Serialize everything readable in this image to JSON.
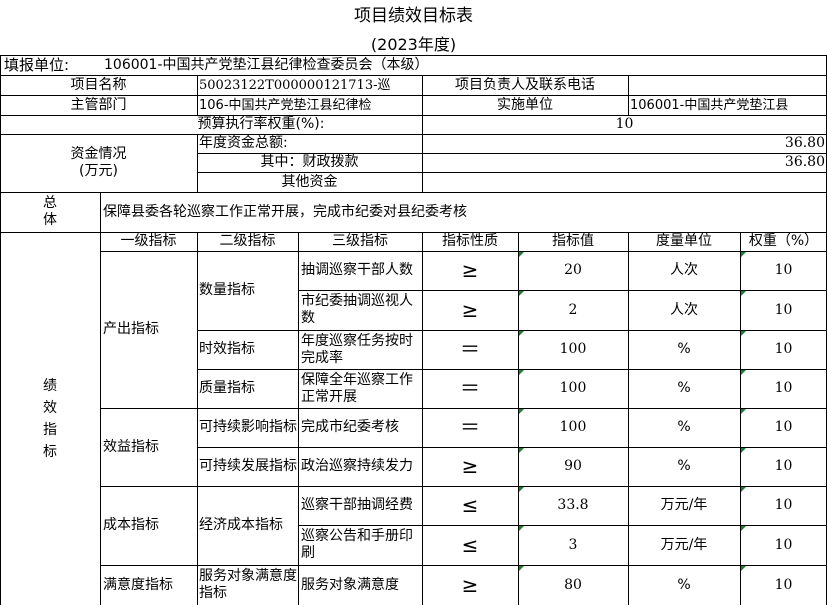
{
  "title": "项目绩效目标表",
  "subtitle": "(2023年度)",
  "reporter": {
    "label": "填报单位:",
    "value": "106001-中国共产党垫江县纪律检查委员会（本级）"
  },
  "project_name": {
    "label": "项目名称",
    "value": "50023122T000000121713-巡"
  },
  "contact": {
    "label": "项目负责人及联系电话",
    "value": ""
  },
  "dept": {
    "label": "主管部门",
    "value": "106-中国共产党垫江县纪律检"
  },
  "impl": {
    "label": "实施单位",
    "value": "106001-中国共产党垫江县"
  },
  "weight_row": {
    "label": "预算执行率权重(%):",
    "value": "10"
  },
  "funds": {
    "label": "资金情况\n(万元)",
    "total_label": "年度资金总额:",
    "total": "36.80",
    "fiscal_label": "其中：财政拨款",
    "fiscal": "36.80",
    "other_label": "其他资金",
    "other": ""
  },
  "overall": {
    "label": "总\n体",
    "text": "保障县委各轮巡察工作正常开展，完成市纪委对县纪委考核"
  },
  "perf_label": "绩\n效\n指\n标",
  "headers": [
    "一级指标",
    "二级指标",
    "三级指标",
    "指标性质",
    "指标值",
    "度量单位",
    "权重（%）"
  ],
  "level1": [
    "产出指标",
    "效益指标",
    "成本指标",
    "满意度指标"
  ],
  "level2": [
    "数量指标",
    "时效指标",
    "质量指标",
    "可持续影响指标",
    "可持续发展指标",
    "经济成本指标",
    "服务对象满意度指标"
  ],
  "rows": [
    {
      "l3": "抽调巡察干部人数",
      "nature": "≥",
      "value": "20",
      "unit": "人次",
      "weight": "10"
    },
    {
      "l3": "市纪委抽调巡视人数",
      "nature": "≥",
      "value": "2",
      "unit": "人次",
      "weight": "10"
    },
    {
      "l3": "年度巡察任务按时完成率",
      "nature": "＝",
      "value": "100",
      "unit": "%",
      "weight": "10"
    },
    {
      "l3": "保障全年巡察工作正常开展",
      "nature": "＝",
      "value": "100",
      "unit": "%",
      "weight": "10"
    },
    {
      "l3": "完成市纪委考核",
      "nature": "＝",
      "value": "100",
      "unit": "%",
      "weight": "10"
    },
    {
      "l3": "政治巡察持续发力",
      "nature": "≥",
      "value": "90",
      "unit": "%",
      "weight": "10"
    },
    {
      "l3": "巡察干部抽调经费",
      "nature": "≤",
      "value": "33.8",
      "unit": "万元/年",
      "weight": "10"
    },
    {
      "l3": "巡察公告和手册印刷",
      "nature": "≤",
      "value": "3",
      "unit": "万元/年",
      "weight": "10"
    },
    {
      "l3": "服务对象满意度",
      "nature": "≥",
      "value": "80",
      "unit": "%",
      "weight": "10"
    }
  ]
}
